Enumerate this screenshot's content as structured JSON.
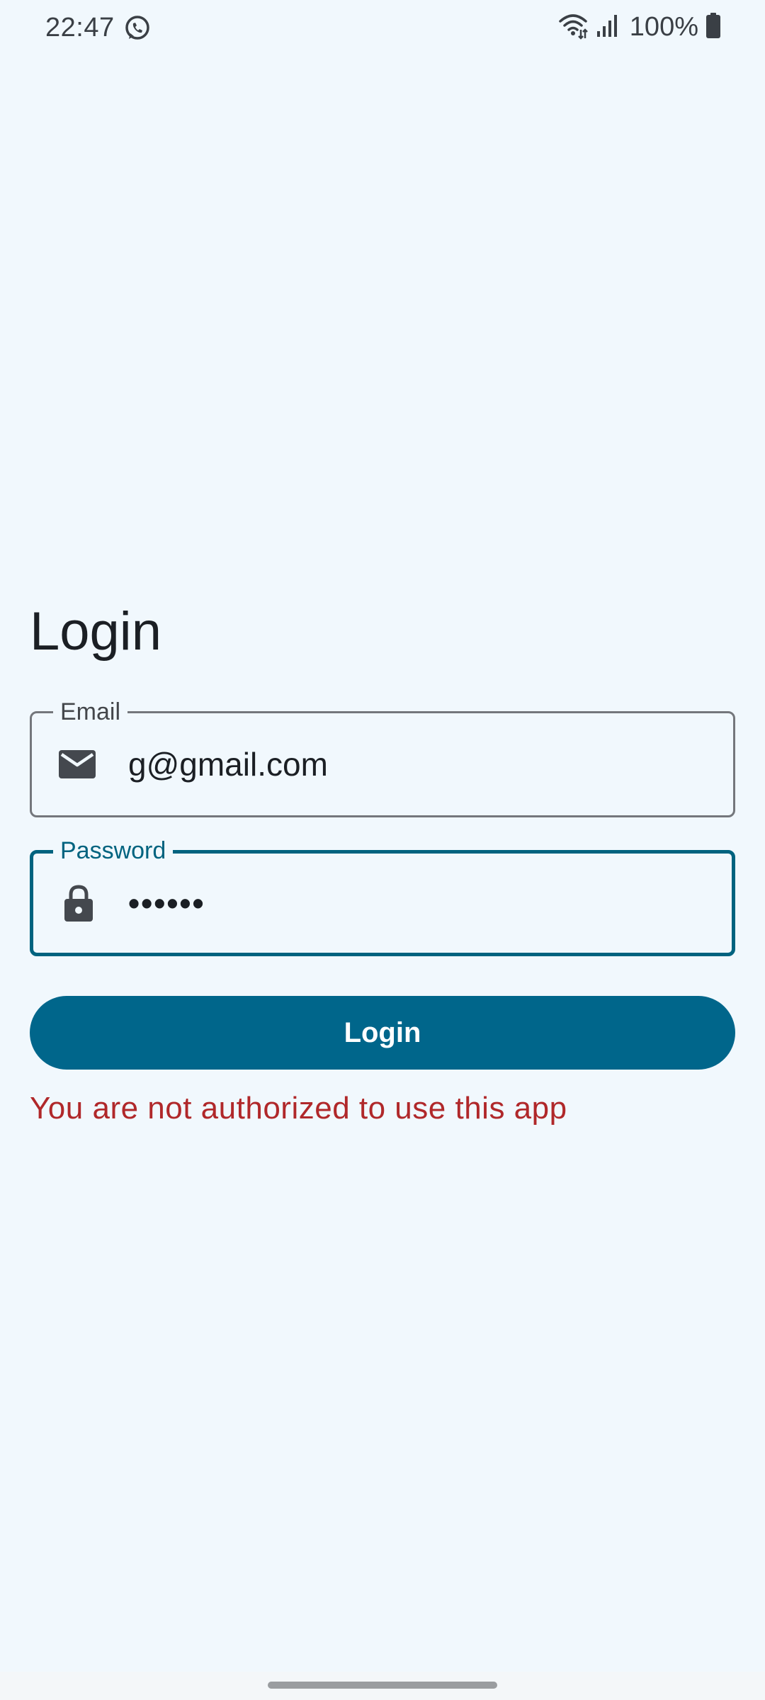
{
  "status_bar": {
    "time": "22:47",
    "notification_icon": "whatsapp-icon",
    "wifi_icon": "wifi-icon",
    "signal_icon": "cell-signal-icon",
    "battery_text": "100%",
    "battery_icon": "battery-icon"
  },
  "page": {
    "title": "Login"
  },
  "email_field": {
    "label": "Email",
    "value": "g@gmail.com",
    "icon": "mail-icon"
  },
  "password_field": {
    "label": "Password",
    "value": "••••••",
    "icon": "lock-icon"
  },
  "login_button": {
    "label": "Login"
  },
  "error": {
    "message": "You are not authorized to use this app"
  },
  "colors": {
    "background": "#f1f8fd",
    "primary": "#00668b",
    "focus_outline": "#00637f",
    "error": "#b0282a",
    "outline": "#74777c"
  }
}
